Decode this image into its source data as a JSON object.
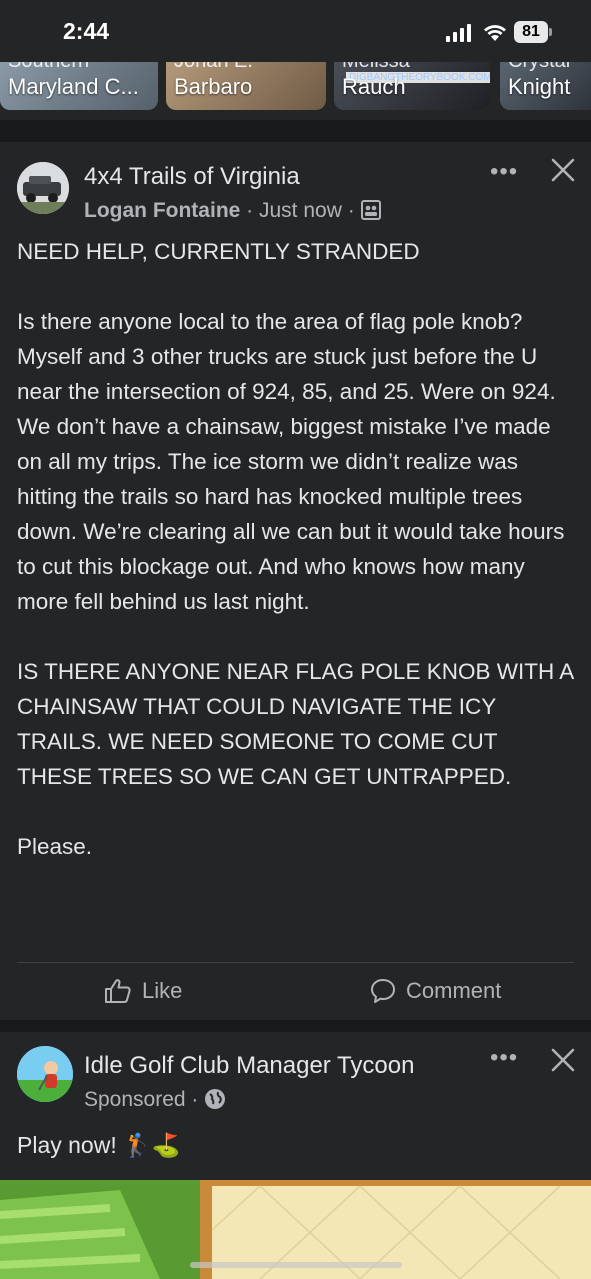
{
  "status_bar": {
    "time": "2:44",
    "battery": "81"
  },
  "stories": [
    {
      "top": "Southern",
      "label": "Maryland C..."
    },
    {
      "top": "Jonah E.",
      "label": "Barbaro"
    },
    {
      "top": "Melissa",
      "label": "Rauch",
      "watermark": "DIGBANGTHEORYBOOK.COM"
    },
    {
      "top": "Crystal",
      "label": "Knight"
    }
  ],
  "post": {
    "group": "4x4 Trails of Virginia",
    "author": "Logan Fontaine",
    "time": "Just now",
    "body": "NEED HELP, CURRENTLY STRANDED\n\nIs there anyone local to the area of flag pole knob? Myself and 3 other trucks are stuck just before the U near the intersection of 924, 85, and 25. Were on 924. We don’t have a chainsaw, biggest mistake I’ve made on all my trips. The ice storm we didn’t realize was hitting the trails so hard has knocked multiple trees down. We’re clearing all we can but it would take hours to cut this blockage out. And who knows how many more fell behind us last night.\n\nIS THERE ANYONE NEAR FLAG POLE KNOB WITH A CHAINSAW THAT COULD NAVIGATE THE ICY TRAILS. WE NEED SOMEONE TO COME CUT THESE TREES SO WE CAN GET UNTRAPPED.\n\nPlease.",
    "like_label": "Like",
    "comment_label": "Comment"
  },
  "ad": {
    "name": "Idle Golf Club Manager Tycoon",
    "sponsored": "Sponsored",
    "text": "Play now! 🏌️⛳"
  },
  "colors": {
    "background": "#242526",
    "separator": "#18191a",
    "text": "#e4e6eb",
    "secondary_text": "#b0b3b8"
  }
}
